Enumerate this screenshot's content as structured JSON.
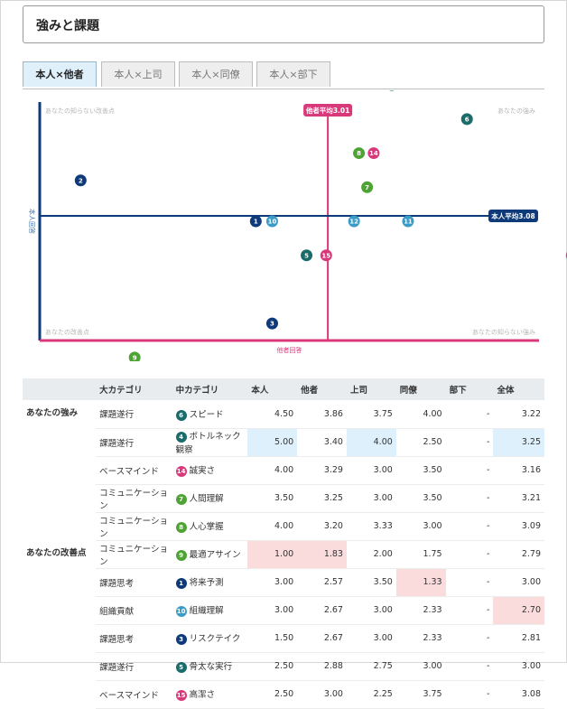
{
  "header": {
    "title": "強みと課題"
  },
  "tabs": [
    {
      "label": "本人×他者",
      "active": true
    },
    {
      "label": "本人×上司",
      "active": false
    },
    {
      "label": "本人×同僚",
      "active": false
    },
    {
      "label": "本人×部下",
      "active": false
    }
  ],
  "colors": {
    "navy": "#0e3a7a",
    "blue": "#3a9cc6",
    "teal": "#1b6b6b",
    "green": "#4ea334",
    "pink": "#d9387a"
  },
  "chart_data": {
    "type": "scatter",
    "xlabel": "他者回答",
    "ylabel": "本人回答",
    "x_average": {
      "label": "他者平均3.01",
      "value": 3.01
    },
    "y_average": {
      "label": "本人平均3.08",
      "value": 3.08
    },
    "xlim": [
      1.25,
      4.3
    ],
    "ylim": [
      1.25,
      4.75
    ],
    "quadrants": {
      "top_left": "あなたの知らない改善点",
      "top_right": "あなたの強み",
      "bottom_left": "あなたの改善点",
      "bottom_right": "あなたの知らない強み"
    },
    "points": [
      {
        "id": "1",
        "x": 2.57,
        "y": 3.0,
        "color": "navy"
      },
      {
        "id": "2",
        "x": 1.5,
        "y": 3.6,
        "color": "navy"
      },
      {
        "id": "3",
        "x": 2.67,
        "y": 1.5,
        "color": "navy"
      },
      {
        "id": "4",
        "x": 3.4,
        "y": 5.0,
        "color": "teal"
      },
      {
        "id": "5",
        "x": 2.88,
        "y": 2.5,
        "color": "teal"
      },
      {
        "id": "6",
        "x": 3.86,
        "y": 4.5,
        "color": "teal"
      },
      {
        "id": "7",
        "x": 3.25,
        "y": 3.5,
        "color": "green"
      },
      {
        "id": "8",
        "x": 3.2,
        "y": 4.0,
        "color": "green"
      },
      {
        "id": "9",
        "x": 1.83,
        "y": 1.0,
        "color": "green"
      },
      {
        "id": "10",
        "x": 2.67,
        "y": 3.0,
        "color": "blue"
      },
      {
        "id": "11",
        "x": 3.5,
        "y": 3.0,
        "color": "blue"
      },
      {
        "id": "12",
        "x": 3.17,
        "y": 3.0,
        "color": "blue"
      },
      {
        "id": "13",
        "x": 4.5,
        "y": 2.5,
        "color": "pink"
      },
      {
        "id": "14",
        "x": 3.29,
        "y": 4.0,
        "color": "pink"
      },
      {
        "id": "15",
        "x": 3.0,
        "y": 2.5,
        "color": "pink"
      }
    ]
  },
  "table": {
    "headers": [
      "",
      "大カテゴリ",
      "中カテゴリ",
      "本人",
      "他者",
      "上司",
      "同僚",
      "部下",
      "全体"
    ],
    "groups": [
      {
        "label": "あなたの強み",
        "rows": [
          {
            "major": "課題遂行",
            "id": "6",
            "color": "teal",
            "minor": "スピード",
            "values": [
              "4.50",
              "3.86",
              "3.75",
              "4.00",
              "-",
              "3.22"
            ],
            "hl": []
          },
          {
            "major": "課題遂行",
            "id": "4",
            "color": "teal",
            "minor": "ボトルネック観察",
            "values": [
              "5.00",
              "3.40",
              "4.00",
              "2.50",
              "-",
              "3.25"
            ],
            "hl": [
              0,
              2,
              5
            ]
          },
          {
            "major": "ベースマインド",
            "id": "14",
            "color": "pink",
            "minor": "誠実さ",
            "values": [
              "4.00",
              "3.29",
              "3.00",
              "3.50",
              "-",
              "3.16"
            ],
            "hl": []
          },
          {
            "major": "コミュニケーション",
            "id": "7",
            "color": "green",
            "minor": "人間理解",
            "values": [
              "3.50",
              "3.25",
              "3.00",
              "3.50",
              "-",
              "3.21"
            ],
            "hl": []
          },
          {
            "major": "コミュニケーション",
            "id": "8",
            "color": "green",
            "minor": "人心掌握",
            "values": [
              "4.00",
              "3.20",
              "3.33",
              "3.00",
              "-",
              "3.09"
            ],
            "hl": []
          }
        ]
      },
      {
        "label": "あなたの改善点",
        "rows": [
          {
            "major": "コミュニケーション",
            "id": "9",
            "color": "green",
            "minor": "最適アサイン",
            "values": [
              "1.00",
              "1.83",
              "2.00",
              "1.75",
              "-",
              "2.79"
            ],
            "hl": [
              0,
              1
            ]
          },
          {
            "major": "課題思考",
            "id": "1",
            "color": "navy",
            "minor": "将来予測",
            "values": [
              "3.00",
              "2.57",
              "3.50",
              "1.33",
              "-",
              "3.00"
            ],
            "hl": [
              3
            ]
          },
          {
            "major": "組織貢献",
            "id": "10",
            "color": "blue",
            "minor": "組織理解",
            "values": [
              "3.00",
              "2.67",
              "3.00",
              "2.33",
              "-",
              "2.70"
            ],
            "hl": [
              5
            ]
          },
          {
            "major": "課題思考",
            "id": "3",
            "color": "navy",
            "minor": "リスクテイク",
            "values": [
              "1.50",
              "2.67",
              "3.00",
              "2.33",
              "-",
              "2.81"
            ],
            "hl": []
          },
          {
            "major": "課題遂行",
            "id": "5",
            "color": "teal",
            "minor": "骨太な実行",
            "values": [
              "2.50",
              "2.88",
              "2.75",
              "3.00",
              "-",
              "3.00"
            ],
            "hl": []
          },
          {
            "major": "ベースマインド",
            "id": "15",
            "color": "pink",
            "minor": "高潔さ",
            "values": [
              "2.50",
              "3.00",
              "2.25",
              "3.75",
              "-",
              "3.08"
            ],
            "hl": []
          }
        ]
      }
    ]
  }
}
